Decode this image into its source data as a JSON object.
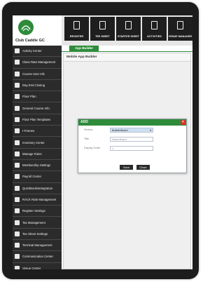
{
  "app": {
    "name": "Club Caddie GC"
  },
  "sidebar": {
    "items": [
      {
        "label": "Activity Center",
        "icon": "activity-icon"
      },
      {
        "label": "Class Rate Management",
        "icon": "rate-icon"
      },
      {
        "label": "Course User Info",
        "icon": "user-icon"
      },
      {
        "label": "Day End Closing",
        "icon": "calendar-icon"
      },
      {
        "label": "Floor Plan",
        "icon": "floorplan-icon"
      },
      {
        "label": "General Course Info.",
        "icon": "info-icon"
      },
      {
        "label": "Floor Plan Templates",
        "icon": "template-icon"
      },
      {
        "label": "I-Frames",
        "icon": "frame-icon"
      },
      {
        "label": "Inventory Center",
        "icon": "inventory-icon"
      },
      {
        "label": "Manage Roles",
        "icon": "roles-icon"
      },
      {
        "label": "Membership Settings",
        "icon": "membership-icon"
      },
      {
        "label": "Payroll Center",
        "icon": "payroll-icon"
      },
      {
        "label": "QuickBooksIntegration",
        "icon": "quickbooks-icon"
      },
      {
        "label": "RACK Rate Management",
        "icon": "rack-icon"
      },
      {
        "label": "Register Settings",
        "icon": "register-icon"
      },
      {
        "label": "Tax Management",
        "icon": "tax-icon"
      },
      {
        "label": "Tee Sheet Settings",
        "icon": "teesheet-icon"
      },
      {
        "label": "Terminal Management",
        "icon": "terminal-icon"
      },
      {
        "label": "Communication Center",
        "icon": "communication-icon"
      },
      {
        "label": "Venue Center",
        "icon": "venue-icon"
      },
      {
        "label": "",
        "icon": "app-builder-icon"
      }
    ]
  },
  "toolbar": {
    "buttons": [
      {
        "label": "REGISTER",
        "icon": "register-icon"
      },
      {
        "label": "TEE SHEET",
        "icon": "tee-sheet-icon"
      },
      {
        "label": "STARTER SHEET",
        "icon": "starter-sheet-icon"
      },
      {
        "label": "ACTIVITIES",
        "icon": "activities-icon"
      },
      {
        "label": "VENUE MANAGER",
        "icon": "venue-manager-icon"
      }
    ]
  },
  "tabs": [
    {
      "label": "App Builder"
    }
  ],
  "main": {
    "title": "Mobile App Builder"
  },
  "modal": {
    "title": "ADD",
    "close_label": "×",
    "fields": {
      "sectn_label": "Section",
      "sectn_value": "BulletinBoard",
      "title_label": "Title",
      "title_placeholder": "News Board",
      "order_label": "Display Order",
      "order_value": "1"
    },
    "save_label": "Save",
    "close_button_label": "Close"
  },
  "colors": {
    "brand_green": "#2e8b3a",
    "close_red": "#d9342b",
    "dark": "#2b2b2b"
  }
}
